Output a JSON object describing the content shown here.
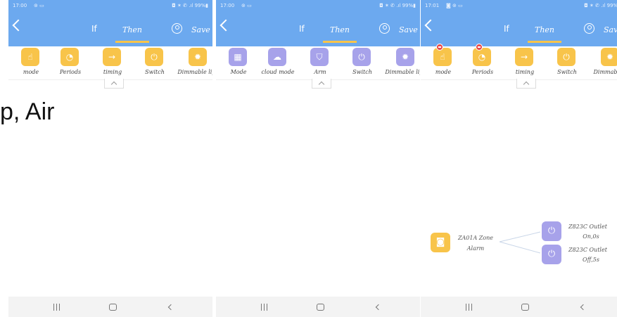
{
  "panels": [
    {
      "status_time": "17:00",
      "status_icons": "⊚ ▭",
      "status_right": "◘ ✶ ✆ .ıl 99%▮",
      "tab_if": "If",
      "tab_then": "Then",
      "save_label": "Save",
      "tools": [
        {
          "label": "mode",
          "color": "#f8c44a",
          "icon": "hand-icon",
          "glyph": "☝"
        },
        {
          "label": "Periods",
          "color": "#f8c44a",
          "icon": "clock-icon",
          "glyph": "◔"
        },
        {
          "label": "timing",
          "color": "#f8c44a",
          "icon": "arrow-right-icon",
          "glyph": "→"
        },
        {
          "label": "Switch",
          "color": "#f8c44a",
          "icon": "power-icon",
          "glyph": "⏻"
        },
        {
          "label": "Dimmable ligh",
          "color": "#f8c44a",
          "icon": "bulb-icon",
          "glyph": "✹"
        }
      ]
    },
    {
      "status_time": "17:00",
      "status_icons": "⊚ ▭",
      "status_right": "◘ ✶ ✆ .ıl 99%▮",
      "tab_if": "If",
      "tab_then": "Then",
      "save_label": "Save",
      "tools": [
        {
          "label": "Mode",
          "color": "#a7a2ea",
          "icon": "grid-icon",
          "glyph": "▦"
        },
        {
          "label": "cloud mode",
          "color": "#a7a2ea",
          "icon": "cloud-icon",
          "glyph": "☁"
        },
        {
          "label": "Arm",
          "color": "#a7a2ea",
          "icon": "shield-icon",
          "glyph": "⛉"
        },
        {
          "label": "Switch",
          "color": "#a7a2ea",
          "icon": "power-icon",
          "glyph": "⏻"
        },
        {
          "label": "Dimmable ligh",
          "color": "#a7a2ea",
          "icon": "bulb-icon",
          "glyph": "✹"
        }
      ]
    },
    {
      "status_time": "17:01",
      "status_icons": "◙ ⊚ ▭",
      "status_right": "◘ ✶ ✆ .ıl 99%▮",
      "tab_if": "If",
      "tab_then": "Then",
      "save_label": "Save",
      "tools": [
        {
          "label": "mode",
          "color": "#f8c44a",
          "icon": "hand-icon",
          "glyph": "☝",
          "badge": true
        },
        {
          "label": "Periods",
          "color": "#f8c44a",
          "icon": "clock-icon",
          "glyph": "◔",
          "badge": true
        },
        {
          "label": "timing",
          "color": "#f8c44a",
          "icon": "arrow-right-icon",
          "glyph": "→"
        },
        {
          "label": "Switch",
          "color": "#f8c44a",
          "icon": "power-icon",
          "glyph": "⏻"
        },
        {
          "label": "Dimmable li",
          "color": "#f8c44a",
          "icon": "bulb-icon",
          "glyph": "✹"
        }
      ]
    }
  ],
  "overlay_text": "p, Air",
  "flow": {
    "trigger": {
      "label_line1": "ZA01A Zone",
      "label_line2": "Alarm",
      "color": "#f8c44a",
      "glyph": "◙"
    },
    "actions": [
      {
        "label_line1": "Z823C Outlet",
        "label_line2": "On,0s",
        "color": "#a7a2ea",
        "glyph": "⏻"
      },
      {
        "label_line1": "Z823C Outlet",
        "label_line2": "Off,5s",
        "color": "#a7a2ea",
        "glyph": "⏻"
      }
    ]
  }
}
